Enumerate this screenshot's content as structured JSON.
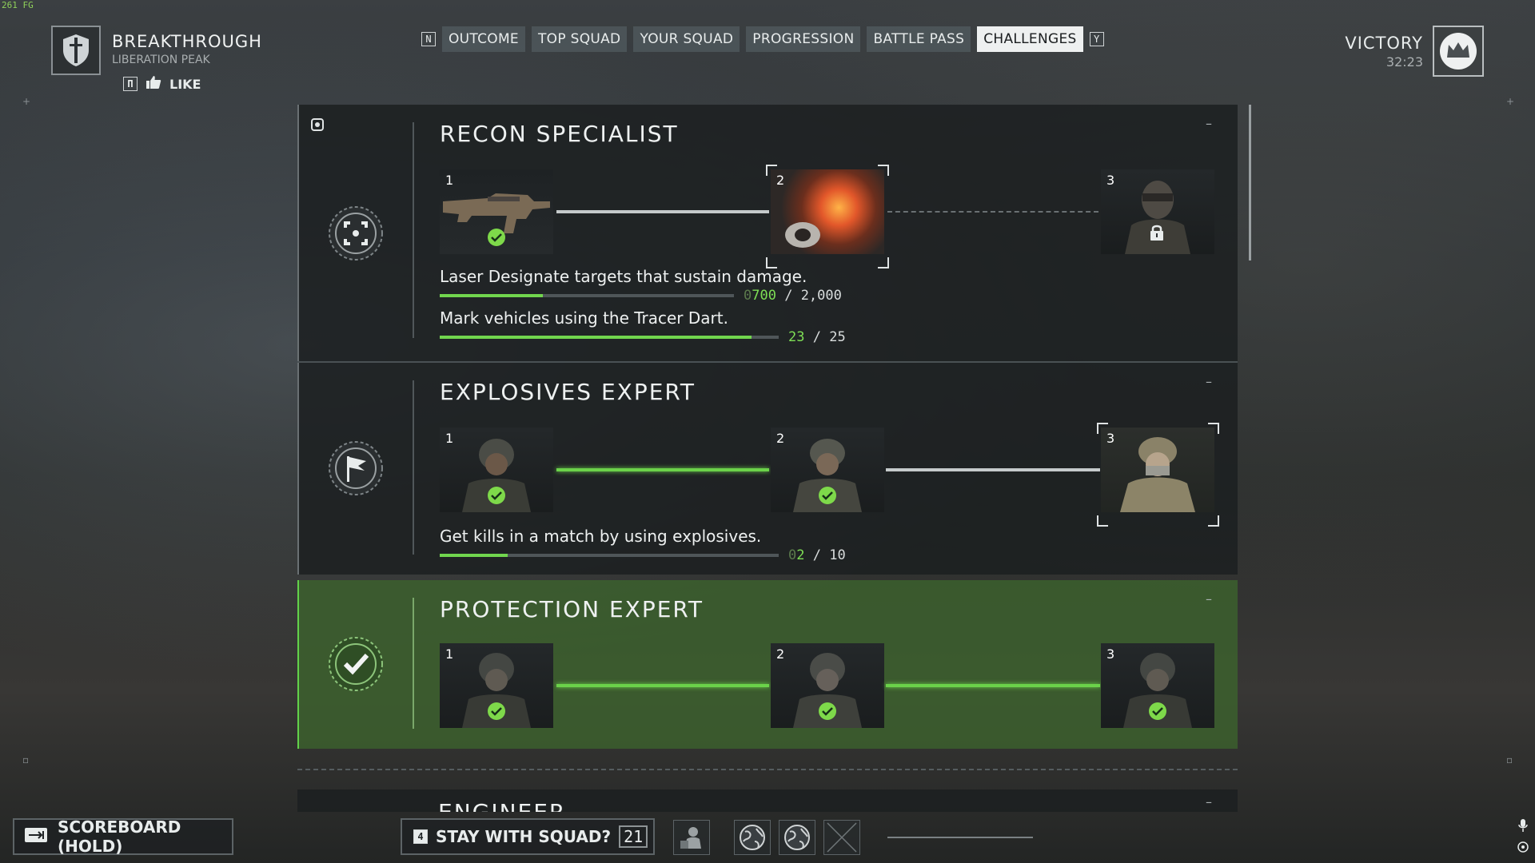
{
  "fps": "261 FG",
  "header": {
    "mode_title": "BREAKTHROUGH",
    "map_name": "LIBERATION PEAK",
    "like_key": "П",
    "like_label": "LIKE",
    "result_title": "VICTORY",
    "match_time": "32:23"
  },
  "tabs": {
    "left_key": "N",
    "right_key": "Y",
    "items": [
      {
        "label": "OUTCOME",
        "active": false
      },
      {
        "label": "TOP SQUAD",
        "active": false
      },
      {
        "label": "YOUR SQUAD",
        "active": false
      },
      {
        "label": "PROGRESSION",
        "active": false
      },
      {
        "label": "BATTLE PASS",
        "active": false
      },
      {
        "label": "CHALLENGES",
        "active": true
      }
    ]
  },
  "challenges": [
    {
      "title": "RECON SPECIALIST",
      "collapse": "–",
      "tiers": [
        {
          "num": "1",
          "state": "completed"
        },
        {
          "num": "2",
          "state": "current"
        },
        {
          "num": "3",
          "state": "locked"
        }
      ],
      "tasks": [
        {
          "text": "Laser Designate targets that sustain damage.",
          "prefix": "0",
          "current": "700",
          "total": "/ 2,000",
          "progress": 0.35
        },
        {
          "text": "Mark vehicles using the Tracer Dart.",
          "prefix": "",
          "current": "23",
          "total": "/ 25",
          "progress": 0.92
        }
      ]
    },
    {
      "title": "EXPLOSIVES EXPERT",
      "collapse": "–",
      "tiers": [
        {
          "num": "1",
          "state": "completed"
        },
        {
          "num": "2",
          "state": "completed"
        },
        {
          "num": "3",
          "state": "current"
        }
      ],
      "tasks": [
        {
          "text": "Get kills in a match by using explosives.",
          "prefix": "0",
          "current": "2",
          "total": "/ 10",
          "progress": 0.2
        }
      ]
    },
    {
      "title": "PROTECTION EXPERT",
      "collapse": "–",
      "tiers": [
        {
          "num": "1",
          "state": "completed"
        },
        {
          "num": "2",
          "state": "completed"
        },
        {
          "num": "3",
          "state": "completed"
        }
      ],
      "tasks": []
    },
    {
      "title": "ENGINEER",
      "collapse": "–"
    }
  ],
  "bottom": {
    "scoreboard_label": "SCOREBOARD (HOLD)",
    "stay_key": "4",
    "stay_label": "STAY WITH SQUAD?",
    "stay_count": "21"
  },
  "colors": {
    "accent_green": "#71d64e",
    "completed_card": "#3c642d",
    "active_tab": "#eef0f0"
  }
}
